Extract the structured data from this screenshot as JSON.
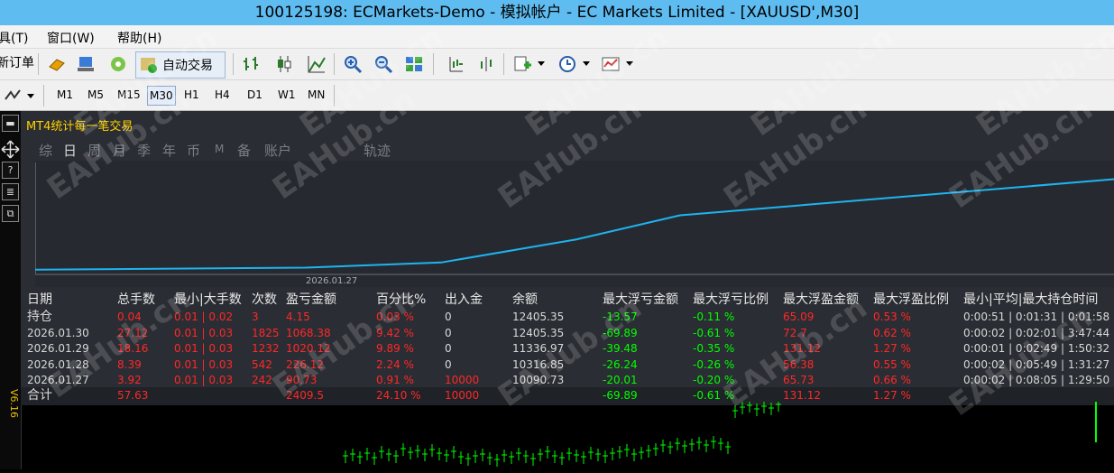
{
  "window": {
    "title": "100125198: ECMarkets-Demo - 模拟帐户 - EC Markets Limited - [XAUUSD',M30]"
  },
  "menu": {
    "items": [
      "具(T)",
      "窗口(W)",
      "帮助(H)"
    ]
  },
  "toolbar": {
    "new_order": "新订单",
    "auto_trade": "自动交易"
  },
  "timeframes": [
    "M1",
    "M5",
    "M15",
    "M30",
    "H1",
    "H4",
    "D1",
    "W1",
    "MN"
  ],
  "active_timeframe": "M30",
  "sidebar": {
    "version": "V6.16"
  },
  "panel": {
    "title": "MT4统计每一笔交易",
    "tabs": [
      "综",
      "日",
      "周",
      "月",
      "季",
      "年",
      "币",
      "M",
      "备",
      "账户",
      "轨迹"
    ],
    "active_tab": "日"
  },
  "watermark": "EAHub.cn",
  "colors": {
    "equity_line": "#1eb4f0",
    "header_text": "#e8e8e8",
    "positive": "#00ff00",
    "negative": "#ff2828",
    "neutral": "#d8d8d8",
    "accent": "#ffd200"
  },
  "chart_data": {
    "type": "line",
    "x_tick_label": "2026.01.27",
    "x": [
      "start",
      "2026.01.27",
      "2026.01.28",
      "2026.01.29",
      "2026.01.30",
      "end"
    ],
    "values": [
      10000,
      10090.73,
      10316.85,
      11336.97,
      12405.35,
      14000
    ],
    "grid": false
  },
  "table": {
    "headers": [
      "日期",
      "总手数",
      "最小|大手数",
      "次数",
      "盈亏金额",
      "百分比%",
      "出入金",
      "余额",
      "最大浮亏金额",
      "最大浮亏比例",
      "最大浮盈金额",
      "最大浮盈比例",
      "最小|平均|最大持仓时间"
    ],
    "rows": [
      [
        "持仓",
        "0.04",
        "0.01 | 0.02",
        "3",
        "4.15",
        "0.03 %",
        "0",
        "12405.35",
        "-13.57",
        "-0.11 %",
        "65.09",
        "0.53 %",
        "0:00:51 | 0:01:31 | 0:01:58"
      ],
      [
        "2026.01.30",
        "27.12",
        "0.01 | 0.03",
        "1825",
        "1068.38",
        "9.42 %",
        "0",
        "12405.35",
        "-69.89",
        "-0.61 %",
        "72.7",
        "0.62 %",
        "0:00:02 | 0:02:01 | 3:47:44"
      ],
      [
        "2026.01.29",
        "18.16",
        "0.01 | 0.03",
        "1232",
        "1020.12",
        "9.89 %",
        "0",
        "11336.97",
        "-39.48",
        "-0.35 %",
        "131.12",
        "1.27 %",
        "0:00:01 | 0:02:49 | 1:50:32"
      ],
      [
        "2026.01.28",
        "8.39",
        "0.01 | 0.03",
        "542",
        "226.12",
        "2.24 %",
        "0",
        "10316.85",
        "-26.24",
        "-0.26 %",
        "56.38",
        "0.55 %",
        "0:00:02 | 0:05:49 | 1:31:27"
      ],
      [
        "2026.01.27",
        "3.92",
        "0.01 | 0.03",
        "242",
        "90.73",
        "0.91 %",
        "10000",
        "10090.73",
        "-20.01",
        "-0.20 %",
        "65.73",
        "0.66 %",
        "0:00:02 | 0:08:05 | 1:29:50"
      ]
    ],
    "total": [
      "合计",
      "57.63",
      "",
      "",
      "2409.5",
      "24.10 %",
      "10000",
      "",
      "-69.89",
      "-0.61 %",
      "131.12",
      "1.27 %",
      ""
    ]
  }
}
